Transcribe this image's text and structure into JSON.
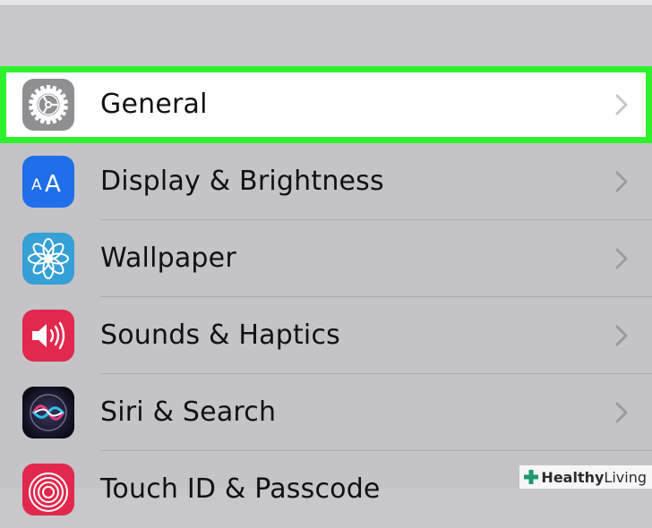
{
  "settings": {
    "items": [
      {
        "label": "General",
        "icon": "gear-icon",
        "color": "#8e8e93"
      },
      {
        "label": "Display & Brightness",
        "icon": "text-size-icon",
        "color": "#1f6fe8"
      },
      {
        "label": "Wallpaper",
        "icon": "flower-icon",
        "color": "#34a0d6"
      },
      {
        "label": "Sounds & Haptics",
        "icon": "speaker-icon",
        "color": "#e2284d"
      },
      {
        "label": "Siri & Search",
        "icon": "siri-icon",
        "color": "#1a1a2e"
      },
      {
        "label": "Touch ID & Passcode",
        "icon": "fingerprint-icon",
        "color": "#e2284d"
      }
    ],
    "selected_index": 0,
    "highlight_color": "#2ef12e"
  },
  "watermark": {
    "bold": "Healthy",
    "light": "Living"
  }
}
